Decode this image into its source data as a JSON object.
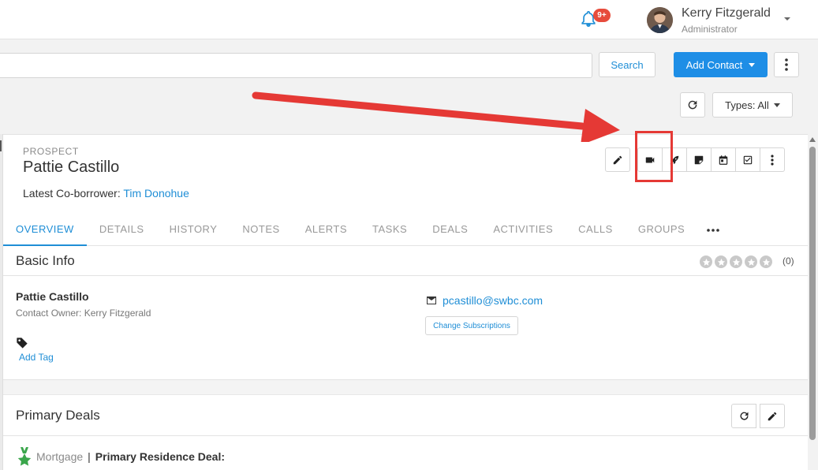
{
  "header": {
    "notification_badge": "9+",
    "user_name": "Kerry Fitzgerald",
    "user_role": "Administrator"
  },
  "toolbar": {
    "search_value": "",
    "search_button": "Search",
    "add_contact_button": "Add Contact",
    "types_filter": "Types: All"
  },
  "contact": {
    "type_label": "PROSPECT",
    "name": "Pattie Castillo",
    "coborrower_label": "Latest Co-borrower:",
    "coborrower_name": "Tim Donohue"
  },
  "actions": [
    "edit-icon",
    "video-icon",
    "rocket-icon",
    "note-icon",
    "calendar-icon",
    "task-check-icon",
    "more-vertical-icon"
  ],
  "tabs": [
    {
      "label": "OVERVIEW",
      "active": true
    },
    {
      "label": "DETAILS",
      "active": false
    },
    {
      "label": "HISTORY",
      "active": false
    },
    {
      "label": "NOTES",
      "active": false
    },
    {
      "label": "ALERTS",
      "active": false
    },
    {
      "label": "TASKS",
      "active": false
    },
    {
      "label": "DEALS",
      "active": false
    },
    {
      "label": "ACTIVITIES",
      "active": false
    },
    {
      "label": "CALLS",
      "active": false
    },
    {
      "label": "GROUPS",
      "active": false
    }
  ],
  "basic_info": {
    "title": "Basic Info",
    "rating": 0,
    "rating_max": 5,
    "rating_count": "(0)",
    "name": "Pattie Castillo",
    "owner": "Contact Owner: Kerry Fitzgerald",
    "add_tag": "Add Tag",
    "email": "pcastillo@swbc.com",
    "subscriptions_button": "Change Subscriptions"
  },
  "primary_deals": {
    "title": "Primary Deals",
    "deal_type": "Mortgage",
    "deal_separator": "|",
    "deal_name": "Primary Residence Deal:"
  },
  "colors": {
    "accent": "#1e8ee6",
    "link": "#1f8ed6",
    "badge": "#e74c3c",
    "annotation": "#e53935",
    "deal_icon": "#3aa64b"
  }
}
